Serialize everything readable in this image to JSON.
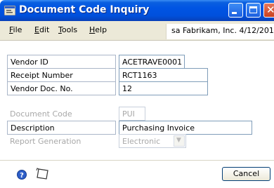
{
  "window": {
    "title": "Document Code Inquiry"
  },
  "menu": {
    "file": "File",
    "edit": "Edit",
    "tools": "Tools",
    "help": "Help"
  },
  "company_info": "sa  Fabrikam, Inc.  4/12/2017",
  "fields": {
    "vendor_id": {
      "label": "Vendor ID",
      "value": "ACETRAVE0001"
    },
    "receipt_number": {
      "label": "Receipt Number",
      "value": "RCT1163"
    },
    "vendor_doc_no": {
      "label": "Vendor Doc. No.",
      "value": "12"
    },
    "document_code": {
      "label": "Document Code",
      "value": "PUI"
    },
    "description": {
      "label": "Description",
      "value": "Purchasing Invoice"
    },
    "report_generation": {
      "label": "Report Generation",
      "value": "Electronic"
    }
  },
  "buttons": {
    "cancel": "Cancel"
  },
  "icons": {
    "app": "document-window-icon",
    "help": "help-question-icon",
    "note": "note-icon"
  },
  "colors": {
    "titlebar": "#0054e3",
    "menubar": "#ece9d8",
    "close_button": "#d75a36",
    "disabled_text": "#a8a8a8"
  }
}
